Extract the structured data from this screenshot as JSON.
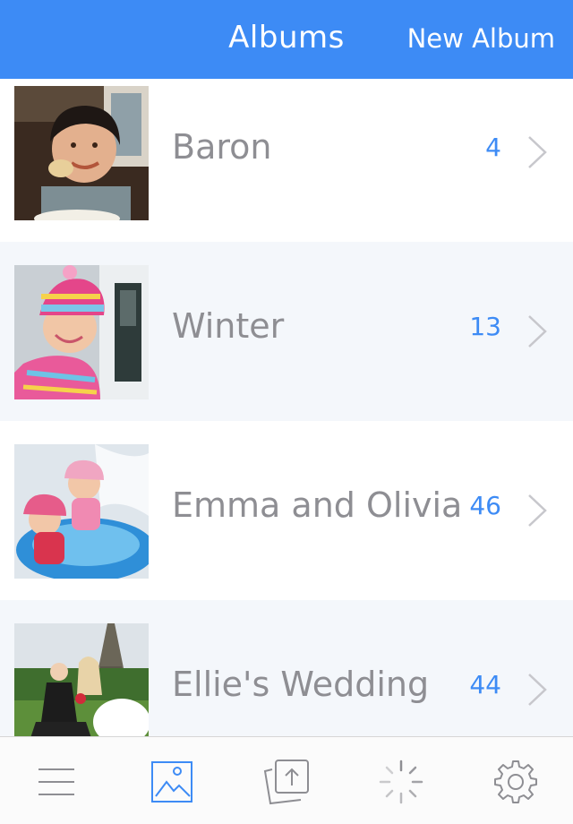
{
  "nav": {
    "title": "Albums",
    "new_album_label": "New Album"
  },
  "albums": [
    {
      "name": "Baron",
      "count": "4"
    },
    {
      "name": "Winter",
      "count": "13"
    },
    {
      "name": "Emma and Olivia",
      "count": "46"
    },
    {
      "name": "Ellie's Wedding",
      "count": "44"
    }
  ],
  "tabbar": {
    "tabs": [
      {
        "icon": "menu-icon",
        "selected": false
      },
      {
        "icon": "albums-photo-icon",
        "selected": true
      },
      {
        "icon": "upload-icon",
        "selected": false
      },
      {
        "icon": "activity-spinner-icon",
        "selected": false
      },
      {
        "icon": "settings-gear-icon",
        "selected": false
      }
    ]
  },
  "colors": {
    "accent": "#3d8bf5",
    "album_text": "#8e8e93",
    "alt_row": "#f4f7fb",
    "icon_gray": "#8e8e93"
  }
}
